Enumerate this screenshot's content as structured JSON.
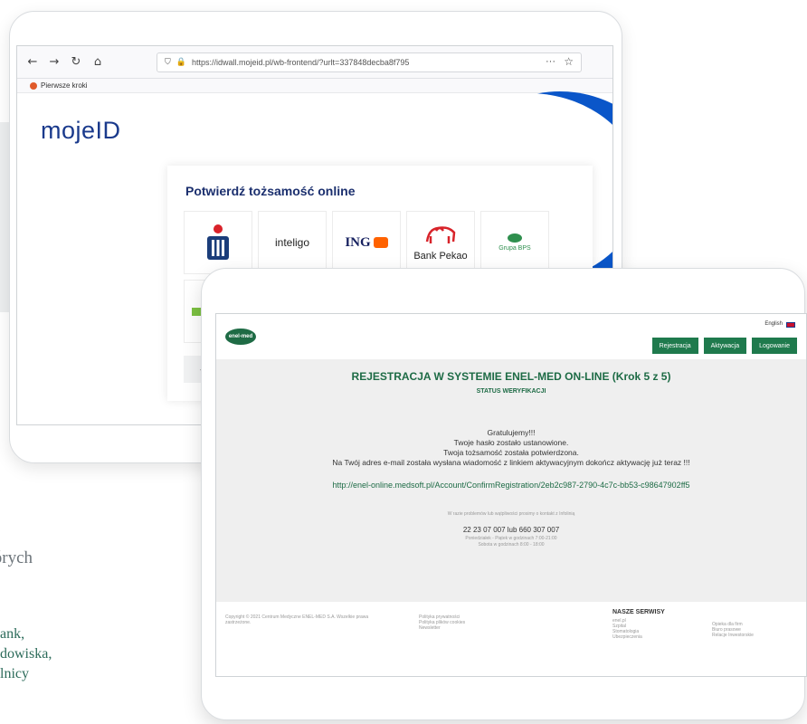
{
  "back_browser": {
    "url": "https://idwall.mojeid.pl/wb-frontend/?urlt=337848decba8f795",
    "url_host_bold": "mojeid.pl",
    "bookmark": "Pierwsze kroki",
    "logo": "mojeID",
    "card_title": "Potwierdź tożsamość online",
    "banks": [
      "inteligo",
      "ING",
      "Bank Pekao",
      "Grupa BPS"
    ]
  },
  "enelmed": {
    "logo": "enel-med",
    "language": "English",
    "nav": [
      "Rejestracja",
      "Aktywacja",
      "Logowanie"
    ],
    "title": "REJESTRACJA W SYSTEMIE ENEL-MED ON-LINE (Krok 5 z 5)",
    "subtitle": "STATUS WERYFIKACJI",
    "message_lines": [
      "Gratulujemy!!!",
      "Twoje hasło zostało ustanowione.",
      "Twoja tożsamość została potwierdzona.",
      "Na Twój adres e-mail została wysłana wiadomość z linkiem aktywacyjnym dokończ aktywację już teraz !!!"
    ],
    "activation_link": "http://enel-online.medsoft.pl/Account/ConfirmRegistration/2eb2c987-2790-4c7c-bb53-c98647902ff5",
    "help_text": "W razie problemów lub wątpliwości prosimy o kontakt z Infolinią",
    "phone": "22 23 07 007 lub 660 307 007",
    "hours_1": "Poniedziałek - Piątek w godzinach 7:00-21:00",
    "hours_2": "Sobota w godzinach 8:00 - 18:00",
    "footer": {
      "copyright": "Copyright © 2021 Centrum Medyczne ENEL-MED S.A. Wszelkie prawa zastrzeżone.",
      "links": [
        "Polityka prywatności",
        "Polityka plików cookies",
        "Newsletter"
      ],
      "services_heading": "NASZE SERWISY",
      "services": [
        "enel.pl",
        "Szpital",
        "Stomatologia",
        "Ubezpieczenia"
      ],
      "other": [
        "Opieka dla firm",
        "Biuro prasowe",
        "Relacje Inwestorskie"
      ]
    }
  },
  "side_text": {
    "grey": "których",
    "green_lines": [
      "ank,",
      "dowiska,",
      "lnicy"
    ]
  }
}
